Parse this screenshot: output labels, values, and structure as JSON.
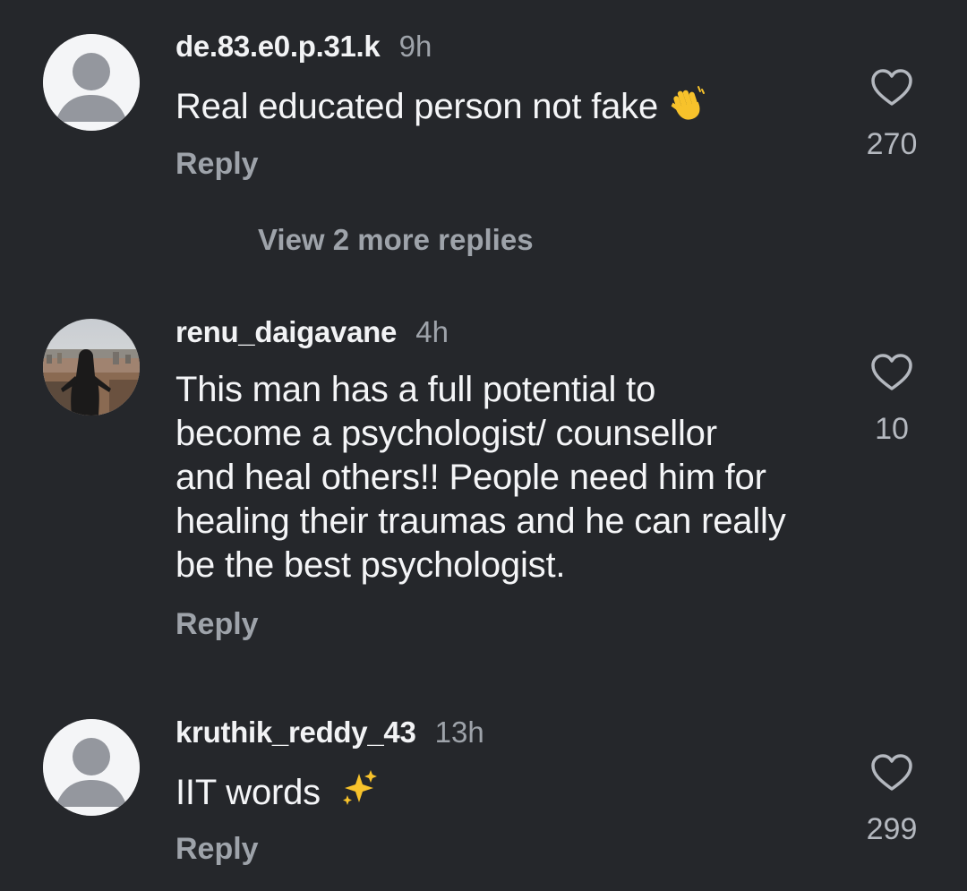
{
  "comments": [
    {
      "username": "de.83.e0.p.31.k",
      "time": "9h",
      "text": "Real educated person not fake",
      "emoji": "waving-hand",
      "reply_label": "Reply",
      "like_count": "270",
      "avatar": "default-avatar"
    },
    {
      "username": "renu_daigavane",
      "time": "4h",
      "text_lines": [
        "This man has a full potential to",
        "become a psychologist/ counsellor",
        "and heal others!! People need him for",
        "healing their traumas and he can really",
        "be the best psychologist."
      ],
      "reply_label": "Reply",
      "like_count": "10",
      "avatar": "photo-avatar"
    },
    {
      "username": "kruthik_reddy_43",
      "time": "13h",
      "text": "IIT words",
      "emoji": "sparkles",
      "reply_label": "Reply",
      "like_count": "299",
      "avatar": "default-avatar"
    }
  ],
  "view_more_replies": "View 2 more replies",
  "colors": {
    "background": "#25272b",
    "text": "#f4f5f7",
    "muted": "#9ea3aa",
    "emoji_yellow": "#f7c22b"
  }
}
